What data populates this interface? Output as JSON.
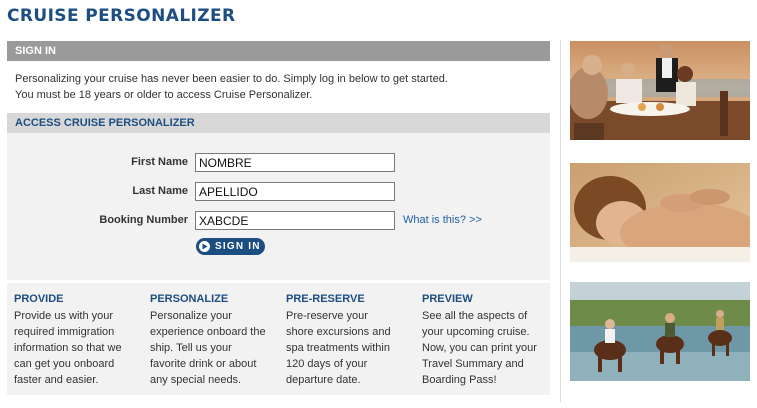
{
  "page": {
    "title": "CRUISE PERSONALIZER"
  },
  "signin": {
    "header": "SIGN IN",
    "intro_line1": "Personalizing your cruise has never been easier to do. Simply log in below to get started.",
    "intro_line2": "You must be 18 years or older to access Cruise Personalizer."
  },
  "access": {
    "header": "ACCESS CRUISE PERSONALIZER",
    "fields": [
      {
        "label": "First Name",
        "value": "NOMBRE"
      },
      {
        "label": "Last Name",
        "value": "APELLIDO"
      },
      {
        "label": "Booking Number",
        "value": "XABCDE"
      }
    ],
    "help_link": "What is this? >>",
    "submit_label": "SIGN IN"
  },
  "info": [
    {
      "title": "PROVIDE",
      "lines": [
        "Provide us with your",
        "required immigration",
        "information so that we",
        "can get you onboard",
        "faster and easier."
      ]
    },
    {
      "title": "PERSONALIZE",
      "lines": [
        "Personalize your",
        "experience onboard the",
        "ship. Tell us your",
        "favorite drink or about",
        "any special needs."
      ]
    },
    {
      "title": "PRE-RESERVE",
      "lines": [
        "Pre-reserve your",
        "shore excursions and",
        "spa treatments within",
        "120 days of your",
        "departure date."
      ]
    },
    {
      "title": "PREVIEW",
      "lines": [
        "See all the aspects of",
        "your upcoming cruise.",
        "Now, you can print your",
        "Travel Summary and",
        "Boarding Pass!"
      ]
    }
  ],
  "photos": [
    {
      "subject": "dining-photo"
    },
    {
      "subject": "spa-massage-photo"
    },
    {
      "subject": "horseback-riding-photo"
    }
  ],
  "colors": {
    "brand_blue": "#1c4e82",
    "link_blue": "#1f5fa6",
    "signin_bar": "#9a9a9a",
    "access_bar": "#d8d8d8",
    "panel_bg": "#f2f2f2"
  }
}
